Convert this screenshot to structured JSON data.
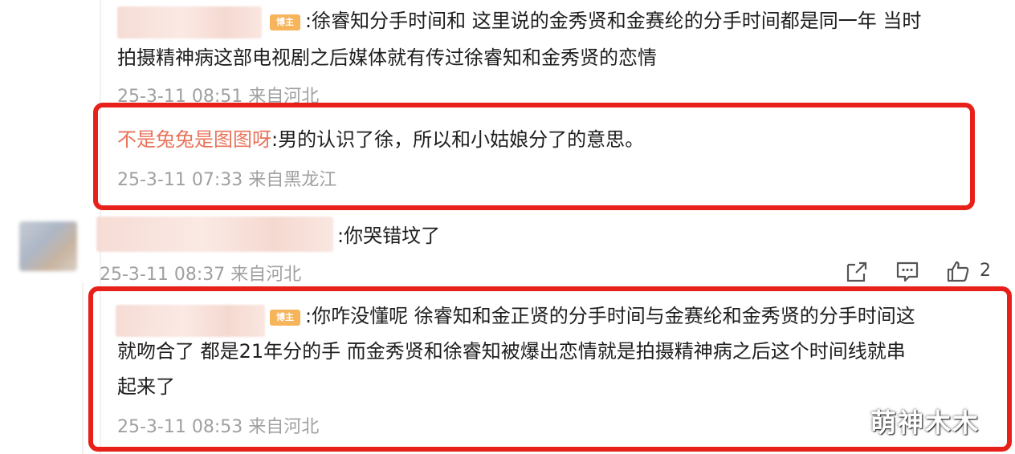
{
  "comments": [
    {
      "badge": "博主",
      "text_line1": ":徐睿知分手时间和 这里说的金秀贤和金赛纶的分手时间都是同一年 当时",
      "text_line2": "拍摄精神病这部电视剧之后媒体就有传过徐睿知和金秀贤的恋情",
      "meta": "25-3-11 08:51 来自河北"
    },
    {
      "username": "不是兔兔是图图呀",
      "text": ":男的认识了徐，所以和小姑娘分了的意思。",
      "meta": "25-3-11 07:33 来自黑龙江"
    },
    {
      "text": ":你哭错坟了",
      "meta": "25-3-11 08:37 来自河北",
      "like_count": "2"
    },
    {
      "badge": "博主",
      "text_line1": ":你咋没懂呢 徐睿知和金正贤的分手时间与金赛纶和金秀贤的分手时间这",
      "text_line2": "就吻合了 都是21年分的手 而金秀贤和徐睿知被爆出恋情就是拍摄精神病之后这个时间线就串",
      "text_line3": "起来了",
      "meta": "25-3-11 08:53 来自河北"
    }
  ],
  "icons": {
    "share": "share-icon",
    "comment": "comment-icon",
    "like": "thumbs-up-icon"
  },
  "watermark": "萌神木木",
  "colors": {
    "highlight_border": "#e8201a",
    "username": "#e9735a",
    "meta": "#a0a0a0",
    "badge": "#f6b45b"
  }
}
